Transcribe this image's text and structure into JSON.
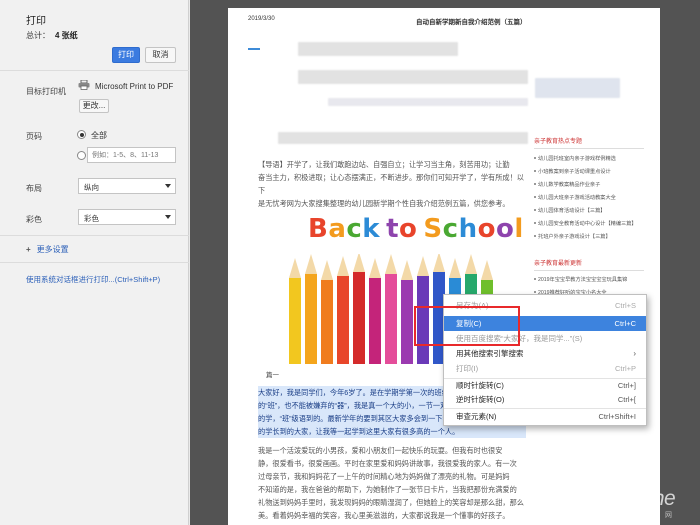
{
  "panel": {
    "title": "打印",
    "total_label": "总计：",
    "total_value": "4 张纸",
    "print_button": "打印",
    "cancel_button": "取消",
    "destination_label": "目标打印机",
    "printer_name": "Microsoft Print to PDF",
    "change_button": "更改...",
    "pages_label": "页码",
    "pages_all": "全部",
    "pages_placeholder": "例如：1-5、8、11-13",
    "layout_label": "布局",
    "layout_value": "纵向",
    "color_label": "彩色",
    "color_value": "彩色",
    "more_settings": "更多设置",
    "system_dialog": "使用系统对话框进行打印...(Ctrl+Shift+P)"
  },
  "preview": {
    "date": "2019/3/30",
    "heading": "自动自新学期新自我介绍范例（五篇）",
    "intro": [
      "【导语】开学了，让我们敢跑边站、自强自立；让学习当主角，刻苦用功；让勤",
      "奋当主力，积极进取；让心态摆满正，不断进步。那你们可知开学了，学有所成！以下",
      "是无忧考网为大家搜集整理的幼儿园新学期个性自我介绍范例五篇，供您参考。"
    ],
    "school_title": [
      "B",
      "a",
      "c",
      "k",
      " ",
      "t",
      "o",
      " ",
      "S",
      "c",
      "h",
      "o",
      "o",
      "l"
    ],
    "caption": "篇一",
    "highlight": [
      "大家好，我是同学们，今年6岁了。是在学期学第一次的班级的入学",
      "的“班”，也不能被嫌弃的“器”，我是真一个大的小，一节一双",
      "的学，“班”级语到的。最新学年的要到其区大家多会到一下参加。",
      "的学长到的大家，让我等一起学到这里大家有很多高的一个人。"
    ],
    "body": [
      "我是一个活泼爱玩的小男孩，爱和小朋友们一起快乐的玩耍。但我有时也很安",
      "静，很爱看书，很爱画画。平时在家里爱和妈妈讲故事，我很爱我的家人。有一次",
      "过母亲节，我和妈妈花了一上午的时间精心地为妈妈做了漂亮的礼物。可是妈妈",
      "不知道的是，我在爸爸的帮助下，为她制作了一张节日卡片，当我把那份充满爱的",
      "礼物送到妈妈手里时，我发现妈妈的眼睛湿润了，但她脸上的笑容却是那么甜，那么",
      "美。看着妈妈幸福的笑容，我心里美滋滋的，大家都说我是一个懂事的好孩子。"
    ],
    "sidebar_hot_title": "亲子教育热点专题",
    "sidebar_hot": [
      "幼儿园托班室内亲子游戏样例精选",
      "小班教案到亲子活动课重点设计",
      "幼儿数学教案精品作业亲子",
      "幼儿园大班亲子游戏活动教案大全",
      "幼儿园体育活动设计【三篇】",
      "幼儿园安全教育活动中心设计【精编三篇】",
      "托班户外亲子游戏设计【三篇】"
    ],
    "sidebar_new_title": "亲子教育最新更新",
    "sidebar_new": [
      "2019年宝宝早教方法宝宝宝宝玩具集锦",
      "2019推荐好听的宝宝小名大全"
    ]
  },
  "context_menu": {
    "items": [
      {
        "label": "另存为(A)...",
        "shortcut": "Ctrl+S",
        "state": "disabled"
      },
      {
        "label": "复制(C)",
        "shortcut": "Ctrl+C",
        "state": "active"
      },
      {
        "label": "使用百度搜索“大家好，我是同学...”(S)",
        "shortcut": "",
        "state": "disabled"
      },
      {
        "label": "用其他搜索引擎搜索",
        "shortcut": "",
        "state": "normal",
        "submenu": true
      },
      {
        "label": "打印(I)",
        "shortcut": "Ctrl+P",
        "state": "disabled"
      },
      {
        "label": "顺时针旋转(C)",
        "shortcut": "Ctrl+]",
        "state": "normal"
      },
      {
        "label": "逆时针旋转(O)",
        "shortcut": "Ctrl+[",
        "state": "normal"
      },
      {
        "label": "审查元素(N)",
        "shortcut": "Ctrl+Shift+I",
        "state": "normal"
      }
    ],
    "submenu_arrow": "›"
  },
  "watermark": {
    "brand": "PConline",
    "sub": "太平洋电脑网"
  },
  "colors": {
    "accent": "#3b7be0",
    "highlight_box": "#e8292b"
  }
}
